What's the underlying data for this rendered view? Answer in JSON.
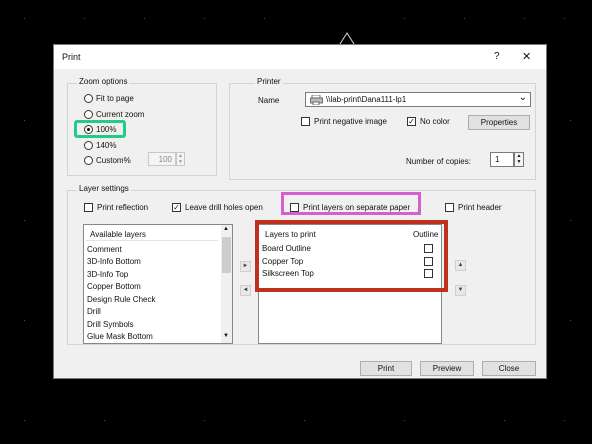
{
  "window": {
    "title": "Print",
    "help_glyph": "?",
    "close_glyph": "✕"
  },
  "zoom": {
    "group_label": "Zoom options",
    "options": [
      "Fit to page",
      "Current zoom",
      "100%",
      "140%",
      "Custom%"
    ],
    "selected": "100%",
    "custom_value": "100"
  },
  "printer": {
    "group_label": "Printer",
    "name_label": "Name",
    "name_value": "\\\\lab-print\\Dana111-lp1",
    "negative_label": "Print negative image",
    "negative_checked": false,
    "nocolor_label": "No color",
    "nocolor_checked": true,
    "properties_label": "Properties",
    "copies_label": "Number of copies:",
    "copies_value": "1"
  },
  "layers": {
    "group_label": "Layer settings",
    "reflection_label": "Print reflection",
    "reflection_checked": false,
    "drill_label": "Leave drill holes open",
    "drill_checked": true,
    "separate_label": "Print layers on separate paper",
    "separate_checked": false,
    "header_label": "Print header",
    "header_checked": false,
    "available_header": "Available layers",
    "available": [
      "Comment",
      "3D-Info Bottom",
      "3D-Info Top",
      "Copper Bottom",
      "Design Rule Check",
      "Drill",
      "Drill Symbols",
      "Glue Mask Bottom"
    ],
    "print_header": "Layers to print",
    "outline_header": "Outline",
    "to_print": [
      "Board Outline",
      "Copper Top",
      "Silkscreen Top"
    ]
  },
  "buttons": {
    "print": "Print",
    "preview": "Preview",
    "close": "Close"
  },
  "glyphs": {
    "right_arrow": "►",
    "left_arrow": "◄",
    "up_arrow": "▲",
    "down_arrow": "▼",
    "check": "✓",
    "chevron": "⌄"
  },
  "colors": {
    "highlight_green": "#22cc88",
    "highlight_pink": "#d65fd0",
    "highlight_red": "#c0301e"
  }
}
